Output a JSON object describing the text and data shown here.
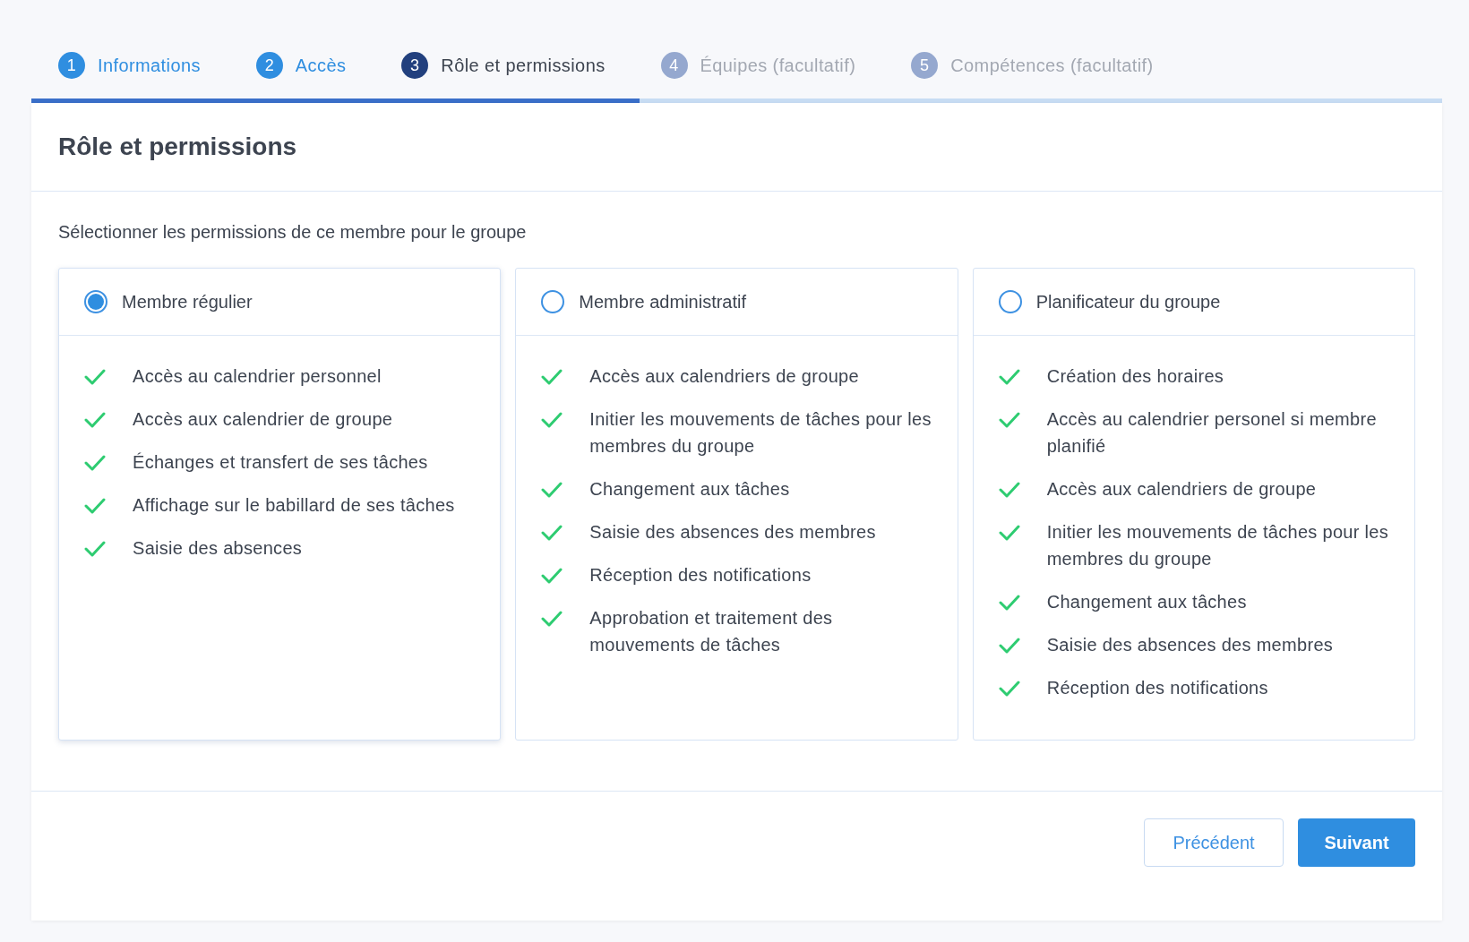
{
  "steps": [
    {
      "number": "1",
      "label": "Informations",
      "completed": true,
      "selected": false
    },
    {
      "number": "2",
      "label": "Accès",
      "completed": true,
      "selected": false
    },
    {
      "number": "3",
      "label": "Rôle et permissions",
      "completed": false,
      "selected": true
    },
    {
      "number": "4",
      "label": "Équipes (facultatif)",
      "completed": false,
      "selected": false
    },
    {
      "number": "5",
      "label": "Compétences (facultatif)",
      "completed": false,
      "selected": false
    }
  ],
  "progress": {
    "level": 0.431
  },
  "panel": {
    "title": "Rôle et permissions",
    "instruction": "Sélectionner les permissions de ce membre pour le groupe"
  },
  "roles": [
    {
      "label": "Membre régulier",
      "selected": true,
      "permissions": [
        "Accès au calendrier personnel",
        "Accès aux calendrier de groupe",
        "Échanges et transfert de ses tâches",
        "Affichage sur le babillard de ses tâches",
        "Saisie des absences"
      ]
    },
    {
      "label": "Membre administratif",
      "selected": false,
      "permissions": [
        "Accès aux calendriers de groupe",
        "Initier les mouvements de tâches pour les membres du groupe",
        "Changement aux tâches",
        "Saisie des absences des membres",
        "Réception des notifications",
        "Approbation et traitement des mouvements de tâches"
      ]
    },
    {
      "label": "Planificateur du groupe",
      "selected": false,
      "permissions": [
        "Création des horaires",
        "Accès au calendrier personel si membre planifié",
        "Accès aux calendriers de groupe",
        "Initier les mouvements de tâches pour les membres du groupe",
        "Changement aux tâches",
        "Saisie des absences des membres",
        "Réception des notifications"
      ]
    }
  ],
  "buttons": {
    "previous": "Précédent",
    "next": "Suivant"
  }
}
